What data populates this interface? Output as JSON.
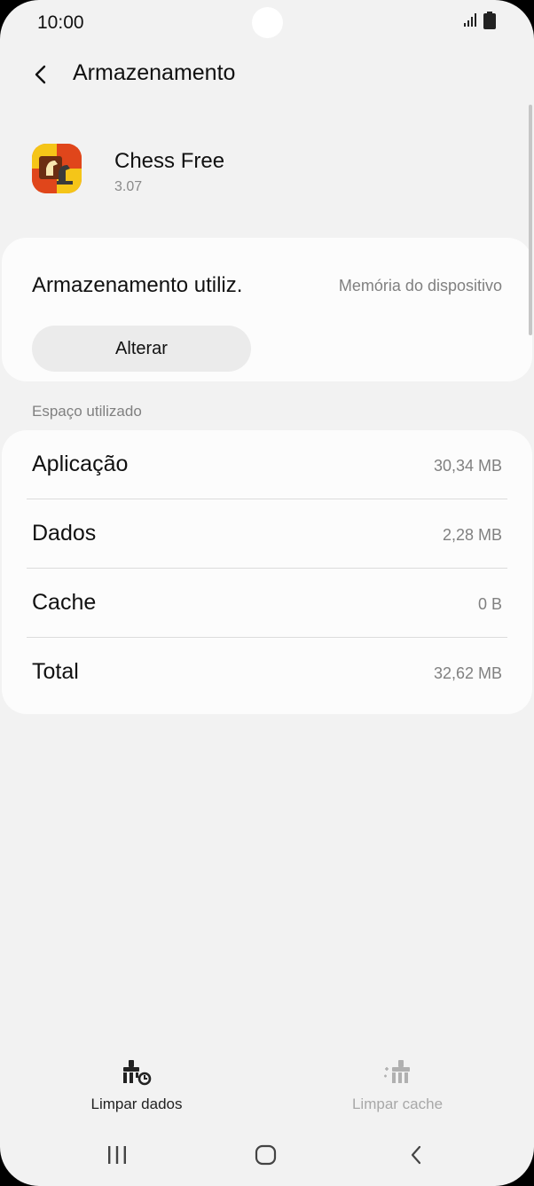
{
  "status_bar": {
    "time": "10:00",
    "signal_icon": "signal-icon",
    "battery_icon": "battery-icon"
  },
  "header": {
    "title": "Armazenamento",
    "back_icon": "back-arrow-icon"
  },
  "app": {
    "name": "Chess Free",
    "version": "3.07",
    "icon": "chess-app-icon"
  },
  "storage_card": {
    "label": "Armazenamento utiliz.",
    "value": "Memória do dispositivo",
    "change_button": "Alterar"
  },
  "space_section": {
    "label": "Espaço utilizado",
    "rows": [
      {
        "label": "Aplicação",
        "value": "30,34 MB"
      },
      {
        "label": "Dados",
        "value": "2,28 MB"
      },
      {
        "label": "Cache",
        "value": "0 B"
      },
      {
        "label": "Total",
        "value": "32,62 MB"
      }
    ]
  },
  "actions": {
    "clear_data": "Limpar dados",
    "clear_cache": "Limpar cache"
  },
  "nav": {
    "recents": "recents-icon",
    "home": "home-icon",
    "back": "back-icon"
  },
  "colors": {
    "background": "#f2f2f2",
    "card": "#fcfcfc",
    "muted_text": "#808080",
    "disabled_text": "#a8a8a8"
  }
}
